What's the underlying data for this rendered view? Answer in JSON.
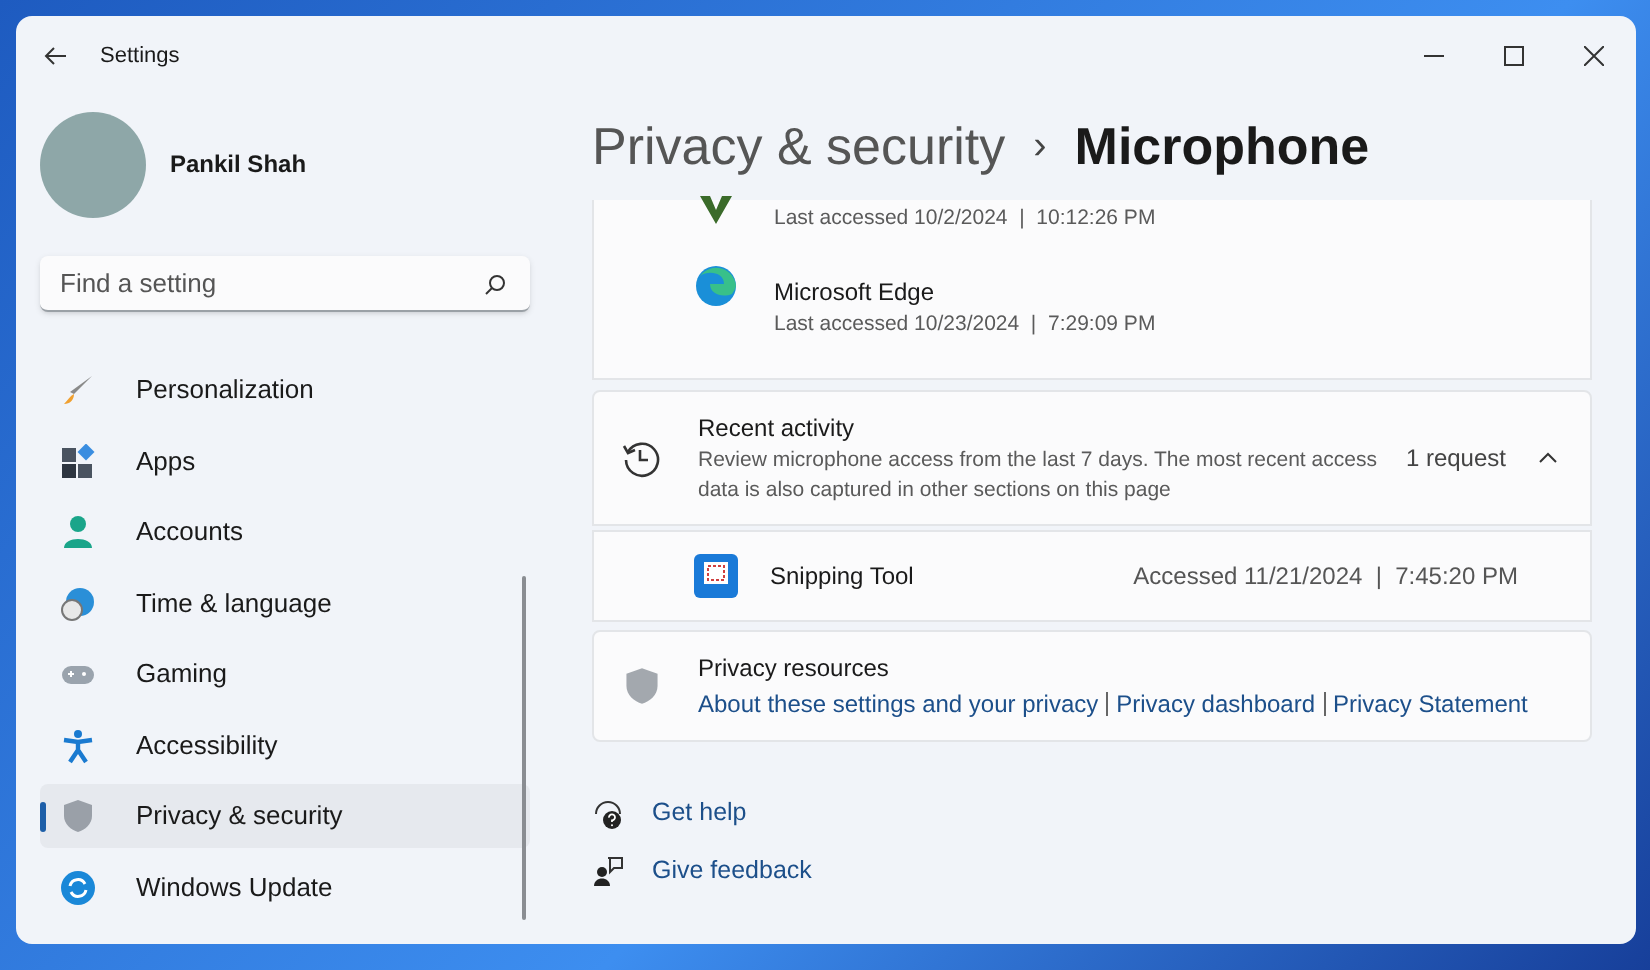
{
  "window": {
    "title": "Settings"
  },
  "profile": {
    "name": "Pankil Shah"
  },
  "search": {
    "placeholder": "Find a setting"
  },
  "sidebar": {
    "items": [
      {
        "label": "Personalization",
        "selected": false
      },
      {
        "label": "Apps",
        "selected": false
      },
      {
        "label": "Accounts",
        "selected": false
      },
      {
        "label": "Time & language",
        "selected": false
      },
      {
        "label": "Gaming",
        "selected": false
      },
      {
        "label": "Accessibility",
        "selected": false
      },
      {
        "label": "Privacy & security",
        "selected": true
      },
      {
        "label": "Windows Update",
        "selected": false
      }
    ]
  },
  "breadcrumb": {
    "parent": "Privacy & security",
    "separator": "›",
    "current": "Microphone"
  },
  "apps": [
    {
      "accessed": "Last accessed 10/2/2024  |  10:12:26 PM"
    },
    {
      "name": "Microsoft Edge",
      "accessed": "Last accessed 10/23/2024  |  7:29:09 PM"
    }
  ],
  "recent_activity": {
    "title": "Recent activity",
    "description": "Review microphone access from the last 7 days. The most recent access data is also captured in other sections on this page",
    "count": "1 request",
    "expanded": true,
    "rows": [
      {
        "name": "Snipping Tool",
        "accessed": "Accessed 11/21/2024  |  7:45:20 PM"
      }
    ]
  },
  "privacy_resources": {
    "title": "Privacy resources",
    "links": [
      "About these settings and your privacy",
      "Privacy dashboard",
      "Privacy Statement"
    ]
  },
  "footer_links": [
    {
      "kind": "help",
      "label": "Get help"
    },
    {
      "kind": "feedback",
      "label": "Give feedback"
    }
  ]
}
